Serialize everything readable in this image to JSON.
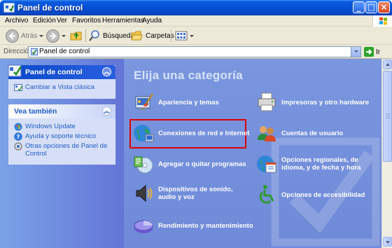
{
  "window": {
    "title": "Panel de control"
  },
  "menubar": {
    "items": [
      "Archivo",
      "Edición",
      "Ver",
      "Favoritos",
      "Herramientas",
      "Ayuda"
    ]
  },
  "toolbar": {
    "back_label": "Atrás",
    "search_label": "Búsqueda",
    "folders_label": "Carpetas"
  },
  "address": {
    "label": "Dirección",
    "value": "Panel de control",
    "go_label": "Ir"
  },
  "sidebar": {
    "control_panel": {
      "title": "Panel de control",
      "links": [
        "Cambiar a Vista clásica"
      ]
    },
    "see_also": {
      "title": "Vea también",
      "links": [
        "Windows Update",
        "Ayuda y soporte técnico",
        "Otras opciones de Panel de Control"
      ]
    }
  },
  "main": {
    "heading": "Elija una categoría",
    "categories": [
      "Apariencia y temas",
      "Impresoras y otro hardware",
      "Conexiones de red e Internet",
      "Cuentas de usuario",
      "Agregar o quitar programas",
      "Opciones regionales, de idioma, y de fecha y hora",
      "Dispositivos de sonido, audio y voz",
      "Opciones de accesibilidad",
      "Rendimiento y mantenimiento"
    ],
    "highlighted_category": "Conexiones de red e Internet"
  },
  "colors": {
    "titlebar": "#0550d6",
    "sidebar": "#6375d6",
    "main_bg": "#7a96df",
    "highlight": "#e00000"
  }
}
